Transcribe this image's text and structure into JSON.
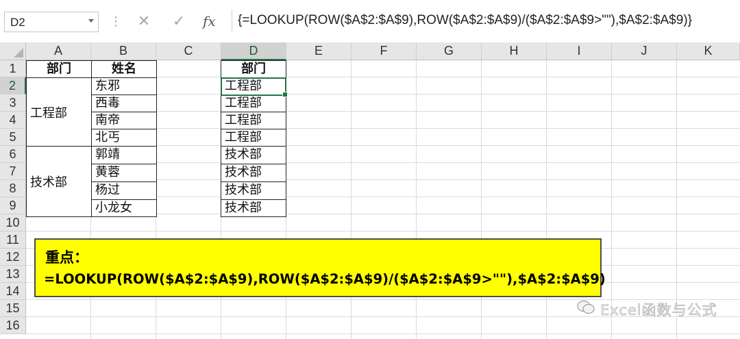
{
  "formula_bar": {
    "name_box": "D2",
    "cancel_icon": "✕",
    "enter_icon": "✓",
    "fx_label": "fx",
    "formula": "{=LOOKUP(ROW($A$2:$A$9),ROW($A$2:$A$9)/($A$2:$A$9>\"\"),$A$2:$A$9)}"
  },
  "columns": [
    "A",
    "B",
    "C",
    "D",
    "E",
    "F",
    "G",
    "H",
    "I",
    "J",
    "K"
  ],
  "rows": [
    "1",
    "2",
    "3",
    "4",
    "5",
    "6",
    "7",
    "8",
    "9",
    "10",
    "11",
    "12",
    "13",
    "14",
    "15",
    "16"
  ],
  "selected_cell": {
    "column": "D",
    "row": "2"
  },
  "table_left": {
    "headers": {
      "dept": "部门",
      "name": "姓名"
    },
    "departments": [
      "工程部",
      "技术部"
    ],
    "names": [
      "东邪",
      "西毒",
      "南帝",
      "北丐",
      "郭靖",
      "黄蓉",
      "杨过",
      "小龙女"
    ]
  },
  "table_right": {
    "header": "部门",
    "values": [
      "工程部",
      "工程部",
      "工程部",
      "工程部",
      "技术部",
      "技术部",
      "技术部",
      "技术部"
    ]
  },
  "note": {
    "title": "重点：",
    "formula": "=LOOKUP(ROW($A$2:$A$9),ROW($A$2:$A$9)/($A$2:$A$9>\"\"),$A$2:$A$9)"
  },
  "watermark": {
    "text": "Excel函数与公式"
  },
  "colors": {
    "accent": "#217346",
    "highlight": "#ffff00"
  }
}
